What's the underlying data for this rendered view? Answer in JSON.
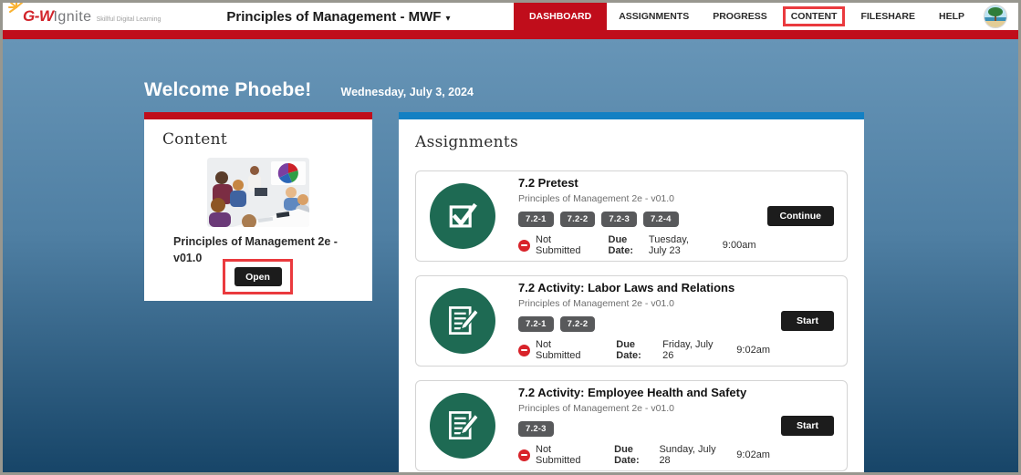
{
  "header": {
    "logo": {
      "gw": "G-W",
      "ignite": "Ignite",
      "tagline": "Skillful Digital Learning"
    },
    "course_selector": {
      "title": "Principles of Management - MWF",
      "caret": "▾"
    },
    "nav": {
      "dashboard": "DASHBOARD",
      "assignments": "ASSIGNMENTS",
      "progress": "PROGRESS",
      "content": "CONTENT",
      "fileshare": "FILESHARE",
      "help": "HELP"
    }
  },
  "welcome": {
    "greeting": "Welcome Phoebe!",
    "date": "Wednesday, July 3, 2024"
  },
  "content_card": {
    "heading": "Content",
    "course_name": "Principles of Management 2e - v01.0",
    "open_button": "Open",
    "thumbnail": "business-meeting-photo"
  },
  "assignments_card": {
    "heading": "Assignments",
    "items": [
      {
        "title": "7.2 Pretest",
        "course": "Principles of Management 2e - v01.0",
        "icon": "checkmark-icon",
        "badges": [
          "7.2-1",
          "7.2-2",
          "7.2-3",
          "7.2-4"
        ],
        "status": "Not Submitted",
        "due_label": "Due Date:",
        "due_date": "Tuesday, July 23",
        "due_time": "9:00am",
        "action": "Continue"
      },
      {
        "title": "7.2 Activity: Labor Laws and Relations",
        "course": "Principles of Management 2e - v01.0",
        "icon": "assignment-pencil-icon",
        "badges": [
          "7.2-1",
          "7.2-2"
        ],
        "status": "Not Submitted",
        "due_label": "Due Date:",
        "due_date": "Friday, July 26",
        "due_time": "9:02am",
        "action": "Start"
      },
      {
        "title": "7.2 Activity: Employee Health and Safety",
        "course": "Principles of Management 2e - v01.0",
        "icon": "assignment-pencil-icon",
        "badges": [
          "7.2-3"
        ],
        "status": "Not Submitted",
        "due_label": "Due Date:",
        "due_date": "Sunday, July 28",
        "due_time": "9:02am",
        "action": "Start"
      }
    ]
  },
  "colors": {
    "brand_red": "#c00d1b",
    "annotation_red": "#ea3a3e",
    "assignments_blue": "#1380c3",
    "icon_green": "#1e6a53",
    "status_red": "#d8232a",
    "badge_gray": "#58595b",
    "bg_gradient_top": "#6795b7",
    "bg_gradient_bottom": "#174568"
  }
}
